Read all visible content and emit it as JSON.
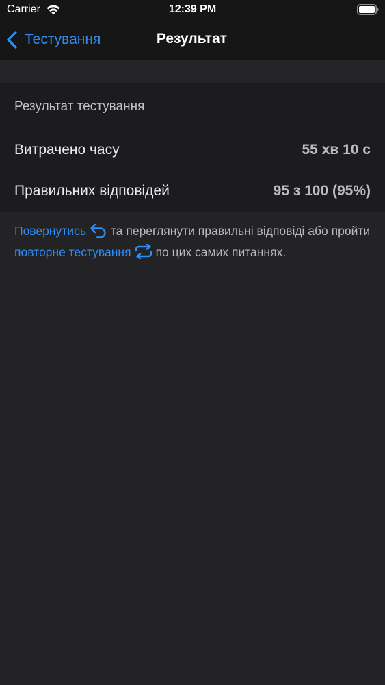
{
  "status_bar": {
    "carrier": "Carrier",
    "time": "12:39 PM",
    "wifi_icon": "wifi-icon",
    "battery_icon": "battery-icon"
  },
  "nav": {
    "back_label": "Тестування",
    "title": "Результат"
  },
  "results": {
    "section_header": "Результат тестування",
    "rows": [
      {
        "label": "Витрачено часу",
        "value": "55 хв 10 с"
      },
      {
        "label": "Правильних відповідей",
        "value": "95 з 100 (95%)"
      }
    ]
  },
  "info": {
    "return_link": "Повернутись",
    "text_part1": "та переглянути правильні відповіді або пройти",
    "retest_link": "повторне тестування",
    "text_part2": "по цих самих питаннях.",
    "return_icon": "return-arrow-icon",
    "repeat_icon": "repeat-icon"
  },
  "colors": {
    "accent": "#2f8cf2",
    "background": "#1c1c1e",
    "nav_background": "#161617"
  }
}
